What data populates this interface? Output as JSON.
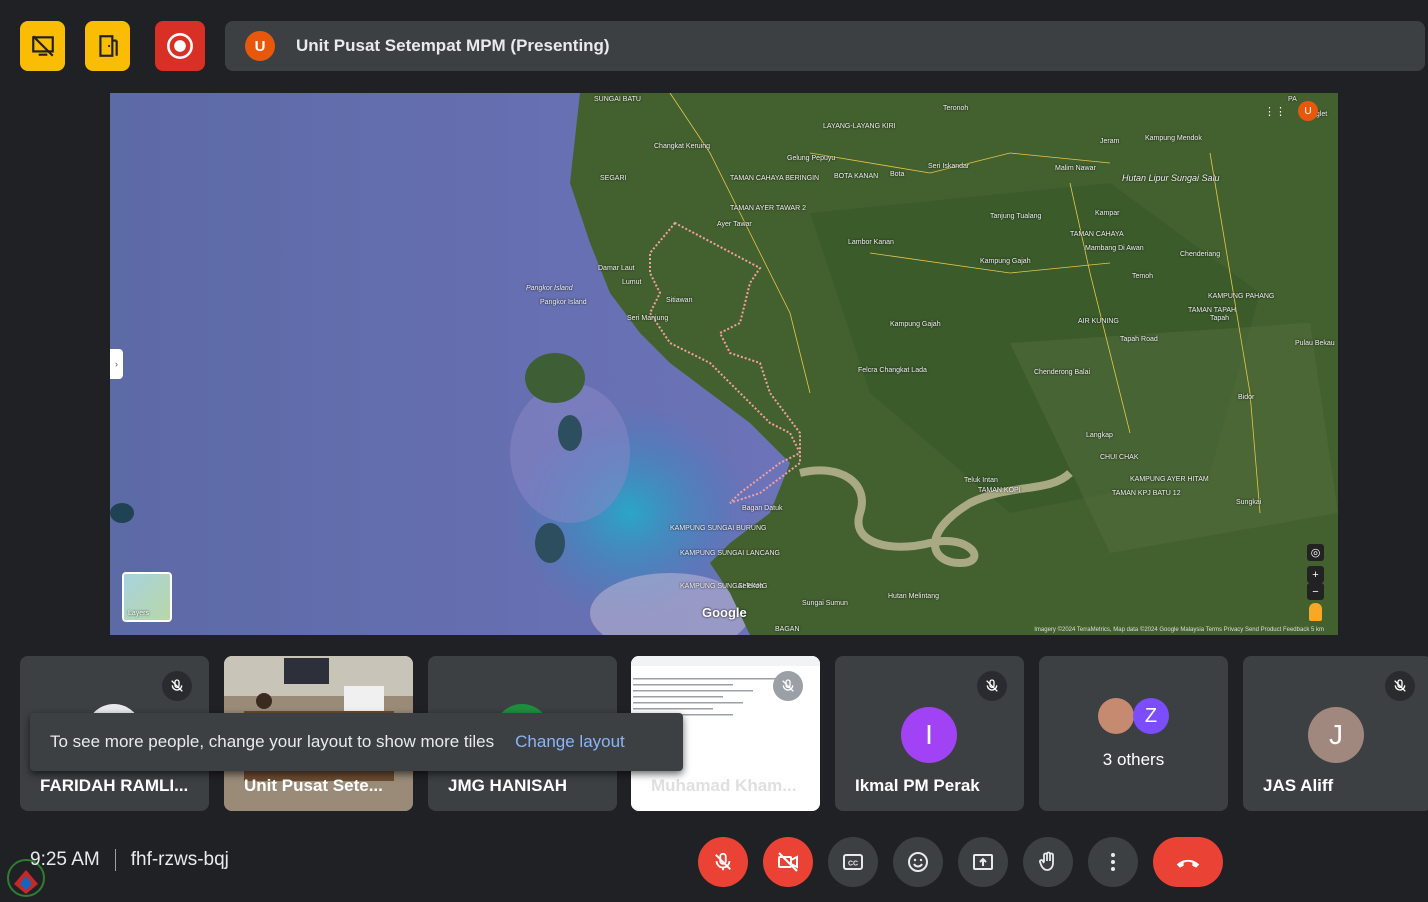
{
  "toolbar": {
    "presenter_avatar_initial": "U",
    "presenter_title": "Unit Pusat Setempat MPM (Presenting)"
  },
  "map": {
    "labels": {
      "sungai_batu": "SUNGAI BATU",
      "changkat_keruing": "Changkat Keruing",
      "segari": "SEGARI",
      "gelung_pepuyu": "Gelung Pepuyu",
      "taman_cahaya_beringin": "TAMAN CAHAYA BERINGIN",
      "layang_layang_kiri": "LAYANG-LAYANG KIRI",
      "bota_kanan": "BOTA KANAN",
      "bota": "Bota",
      "seri_iskandar": "Seri Iskandar",
      "jeram": "Jeram",
      "kampung_mendok": "Kampung Mendok",
      "malim_nawar": "Malim Nawar",
      "hutan_lipur": "Hutan Lipur Sungai Salu",
      "taman_ayer_tawar": "TAMAN AYER TAWAR 2",
      "ayer_tawar": "Ayer Tawar",
      "tanjung_tualang": "Tanjung Tualang",
      "kampar": "Kampar",
      "lambor_kanan": "Lambor Kanan",
      "damar_laut": "Damar Laut",
      "lumut": "Lumut",
      "pangkor_island_1": "Pangkor Island",
      "pangkor_island_2": "Pangkor Island",
      "sitiawan": "Sitiawan",
      "seri_manjung": "Seri Manjung",
      "taman_cahaya": "TAMAN CAHAYA",
      "mambang_di_awan": "Mambang Di Awan",
      "kampung_gajah_1": "Kampung Gajah",
      "chenderiang": "Chenderiang",
      "temoh": "Temoh",
      "kampung_pahang": "KAMPUNG PAHANG",
      "taman_tapah": "TAMAN TAPAH",
      "tapah": "Tapah",
      "air_kuning": "AIR KUNING",
      "kampung_gajah_2": "Kampung Gajah",
      "tapah_road": "Tapah Road",
      "pulau_bekau": "Pulau Bekau",
      "felcra": "Felcra Changkat Lada",
      "chenderong_balai": "Chenderong Balai",
      "bidor": "Bidor",
      "langkap": "Langkap",
      "chui_chak": "CHUI CHAK",
      "teluk_intan": "Teluk Intan",
      "taman_kopi": "TAMAN KOPI",
      "kampung_ayer_hitam": "KAMPUNG AYER HITAM",
      "taman_kpj": "TAMAN KPJ BATU 12",
      "sungkai": "Sungkai",
      "bagan_datuk": "Bagan Datuk",
      "kampung_sungai_burung": "KAMPUNG SUNGAI BURUNG",
      "kampung_sungai_lancang": "KAMPUNG SUNGAI LANCANG",
      "kampung_sungai_tiang": "KAMPUNG SUNGAI TIANG",
      "selekoh": "Selekoh",
      "sungai_sumun": "Sungai Sumun",
      "hutan_melintang": "Hutan Melintang",
      "bagan": "BAGAN",
      "teronoh": "Teronoh",
      "pa": "PA",
      "tanglet": "nglet"
    },
    "layers_label": "Layers",
    "google_logo": "Google",
    "attribution": "Imagery ©2024 TerraMetrics, Map data ©2024 Google    Malaysia    Terms    Privacy    Send Product Feedback    5 km",
    "avatar_initial": "U",
    "zoom_in": "+",
    "zoom_out": "−"
  },
  "participants": [
    {
      "name": "FARIDAH RAMLI...",
      "muted": true
    },
    {
      "name": "Unit Pusat Sete...",
      "muted": false
    },
    {
      "name": "JMG HANISAH",
      "muted": false
    },
    {
      "name": "Muhamad Kham...",
      "muted": true
    },
    {
      "name": "Ikmal PM Perak",
      "initial": "I",
      "muted": true,
      "color": "#a142f4"
    },
    {
      "name": "3 others",
      "initial": "Z",
      "color": "#7c4dff"
    },
    {
      "name": "JAS Aliff",
      "initial": "J",
      "muted": true,
      "color": "#a1887f"
    }
  ],
  "toast": {
    "message": "To see more people, change your layout to show more tiles",
    "action": "Change layout"
  },
  "meeting": {
    "time": "9:25 AM",
    "code": "fhf-rzws-bqj"
  },
  "colors": {
    "background": "#202124",
    "surface": "#3c4043",
    "danger": "#ea4335",
    "warning": "#fbbc04",
    "link": "#8ab4f8"
  }
}
